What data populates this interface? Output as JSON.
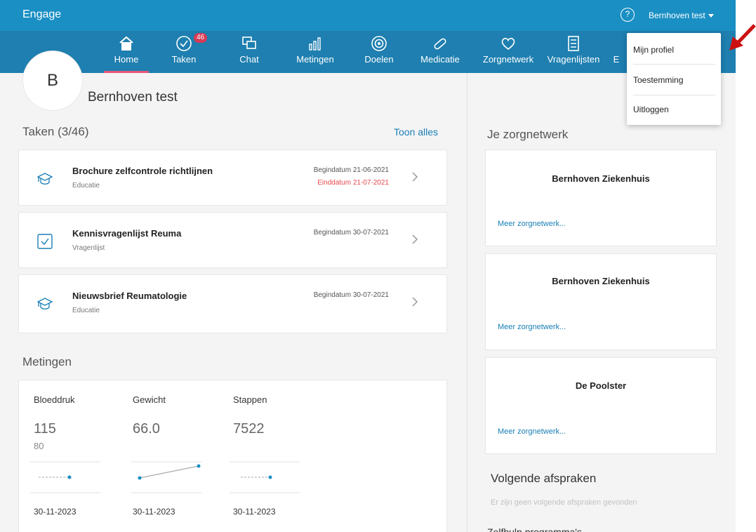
{
  "app": {
    "title": "Engage"
  },
  "header": {
    "help_glyph": "?",
    "user_label": "Bernhoven test"
  },
  "nav": {
    "items": [
      {
        "label": "Home",
        "icon": "home-icon"
      },
      {
        "label": "Taken",
        "icon": "check-circle-icon",
        "badge": "46"
      },
      {
        "label": "Chat",
        "icon": "chat-icon"
      },
      {
        "label": "Metingen",
        "icon": "bar-chart-icon"
      },
      {
        "label": "Doelen",
        "icon": "target-icon"
      },
      {
        "label": "Medicatie",
        "icon": "pill-icon"
      },
      {
        "label": "Zorgnetwerk",
        "icon": "heart-icon"
      },
      {
        "label": "Vragenlijsten",
        "icon": "checklist-icon"
      },
      {
        "label": "E",
        "icon": "more-icon"
      }
    ],
    "accent_color": "#e8557a"
  },
  "profile": {
    "initial": "B",
    "name": "Bernhoven test"
  },
  "tasks": {
    "title": "Taken (3/46)",
    "show_all": "Toon alles",
    "items": [
      {
        "title": "Brochure zelfcontrole richtlijnen",
        "type": "Educatie",
        "start": "Begindatum 21-06-2021",
        "end": "Einddatum 21-07-2021",
        "icon": "graduation-cap-icon"
      },
      {
        "title": "Kennisvragenlijst Reuma",
        "type": "Vragenlijst",
        "start": "Begindatum 30-07-2021",
        "end": "",
        "icon": "checkbox-icon"
      },
      {
        "title": "Nieuwsbrief Reumatologie",
        "type": "Educatie",
        "start": "Begindatum 30-07-2021",
        "end": "",
        "icon": "graduation-cap-icon"
      }
    ]
  },
  "metingen": {
    "title": "Metingen",
    "items": [
      {
        "label": "Bloeddruk",
        "value": "115",
        "sub": "80",
        "date": "30-11-2023"
      },
      {
        "label": "Gewicht",
        "value": "66.0",
        "sub": "",
        "date": "30-11-2023"
      },
      {
        "label": "Stappen",
        "value": "7522",
        "sub": "",
        "date": "30-11-2023"
      }
    ]
  },
  "zorgnetwerk": {
    "title": "Je zorgnetwerk",
    "items": [
      {
        "name": "Bernhoven Ziekenhuis",
        "link": "Meer zorgnetwerk..."
      },
      {
        "name": "Bernhoven Ziekenhuis",
        "link": "Meer zorgnetwerk..."
      },
      {
        "name": "De Poolster",
        "link": "Meer zorgnetwerk..."
      }
    ]
  },
  "afspraken": {
    "title": "Volgende afspraken",
    "empty": "Er zijn geen volgende afspraken gevonden",
    "next_section": "Zelfhulp programma's"
  },
  "user_dropdown": {
    "items": [
      "Mijn profiel",
      "Toestemming",
      "Uitloggen"
    ]
  },
  "colors": {
    "topbar": "#1a8fc4",
    "navbar": "#1e7fb0",
    "link": "#1a7fb5",
    "badge": "#d63b56",
    "end_date": "#e5484d",
    "annotation_arrow": "#cc1111"
  }
}
